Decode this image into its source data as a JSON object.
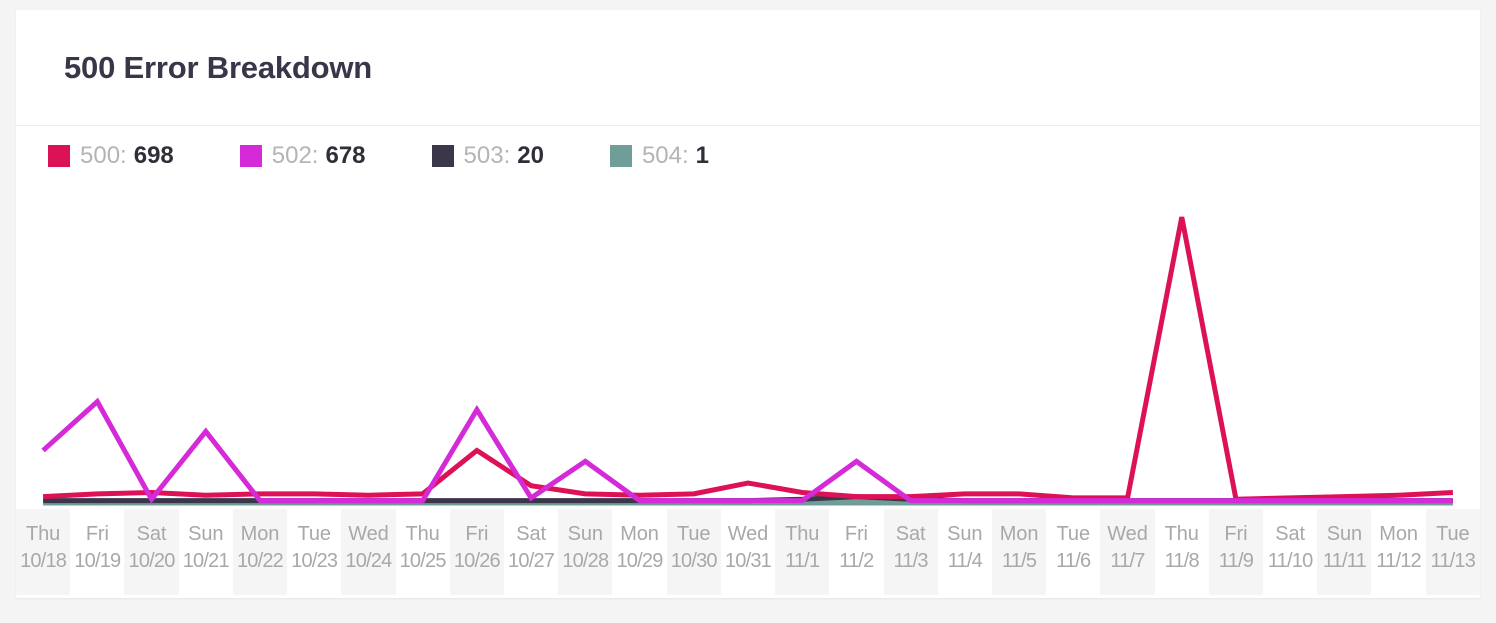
{
  "page": {
    "background_color": "#f4f4f4",
    "card_background": "#ffffff"
  },
  "header": {
    "title": "500 Error Breakdown"
  },
  "legend": {
    "items": [
      {
        "name": "500",
        "label": "500:",
        "value": "698",
        "color": "#dd1155"
      },
      {
        "name": "502",
        "label": "502:",
        "value": "678",
        "color": "#d42ad8"
      },
      {
        "name": "503",
        "label": "503:",
        "value": "20",
        "color": "#3b3649"
      },
      {
        "name": "504",
        "label": "504:",
        "value": "1",
        "color": "#6f9e99"
      }
    ]
  },
  "chart_data": {
    "type": "line",
    "title": "500 Error Breakdown",
    "xlabel": "",
    "ylabel": "",
    "grid": false,
    "legend_position": "top-left",
    "ylim": [
      0,
      230
    ],
    "x": [
      "Thu 10/18",
      "Fri 10/19",
      "Sat 10/20",
      "Sun 10/21",
      "Mon 10/22",
      "Tue 10/23",
      "Wed 10/24",
      "Thu 10/25",
      "Fri 10/26",
      "Sat 10/27",
      "Sun 10/28",
      "Mon 10/29",
      "Tue 10/30",
      "Wed 10/31",
      "Thu 11/1",
      "Fri 11/2",
      "Sat 11/3",
      "Sun 11/4",
      "Mon 11/5",
      "Tue 11/6",
      "Wed 11/7",
      "Thu 11/8",
      "Fri 11/9",
      "Sat 11/10",
      "Sun 11/11",
      "Mon 11/12",
      "Tue 11/13"
    ],
    "x_dow": [
      "Thu",
      "Fri",
      "Sat",
      "Sun",
      "Mon",
      "Tue",
      "Wed",
      "Thu",
      "Fri",
      "Sat",
      "Sun",
      "Mon",
      "Tue",
      "Wed",
      "Thu",
      "Fri",
      "Sat",
      "Sun",
      "Mon",
      "Tue",
      "Wed",
      "Thu",
      "Fri",
      "Sat",
      "Sun",
      "Mon",
      "Tue"
    ],
    "x_date": [
      "10/18",
      "10/19",
      "10/20",
      "10/21",
      "10/22",
      "10/23",
      "10/24",
      "10/25",
      "10/26",
      "10/27",
      "10/28",
      "10/29",
      "10/30",
      "10/31",
      "11/1",
      "11/2",
      "11/3",
      "11/4",
      "11/5",
      "11/6",
      "11/7",
      "11/8",
      "11/9",
      "11/10",
      "11/11",
      "11/12",
      "11/13"
    ],
    "series": [
      {
        "name": "500",
        "color": "#dd1155",
        "values": [
          4,
          6,
          7,
          5,
          6,
          6,
          5,
          6,
          38,
          12,
          6,
          5,
          6,
          14,
          7,
          4,
          4,
          6,
          6,
          3,
          3,
          210,
          2,
          3,
          4,
          5,
          7
        ]
      },
      {
        "name": "502",
        "color": "#d42ad8",
        "values": [
          38,
          74,
          2,
          52,
          1,
          1,
          1,
          1,
          68,
          3,
          30,
          1,
          1,
          1,
          1,
          30,
          1,
          1,
          1,
          1,
          1,
          1,
          1,
          1,
          1,
          1,
          1
        ]
      },
      {
        "name": "503",
        "color": "#3b3649",
        "values": [
          1,
          1,
          1,
          1,
          1,
          1,
          1,
          1,
          1,
          1,
          1,
          1,
          1,
          1,
          2,
          4,
          2,
          1,
          1,
          1,
          1,
          1,
          1,
          1,
          1,
          1,
          1
        ]
      },
      {
        "name": "504",
        "color": "#6f9e99",
        "values": [
          0,
          0,
          0,
          0,
          0,
          0,
          0,
          0,
          0,
          0,
          0,
          0,
          0,
          0,
          0,
          0,
          0,
          0,
          0,
          0,
          0,
          0,
          0,
          0,
          0,
          0,
          0
        ]
      }
    ]
  }
}
